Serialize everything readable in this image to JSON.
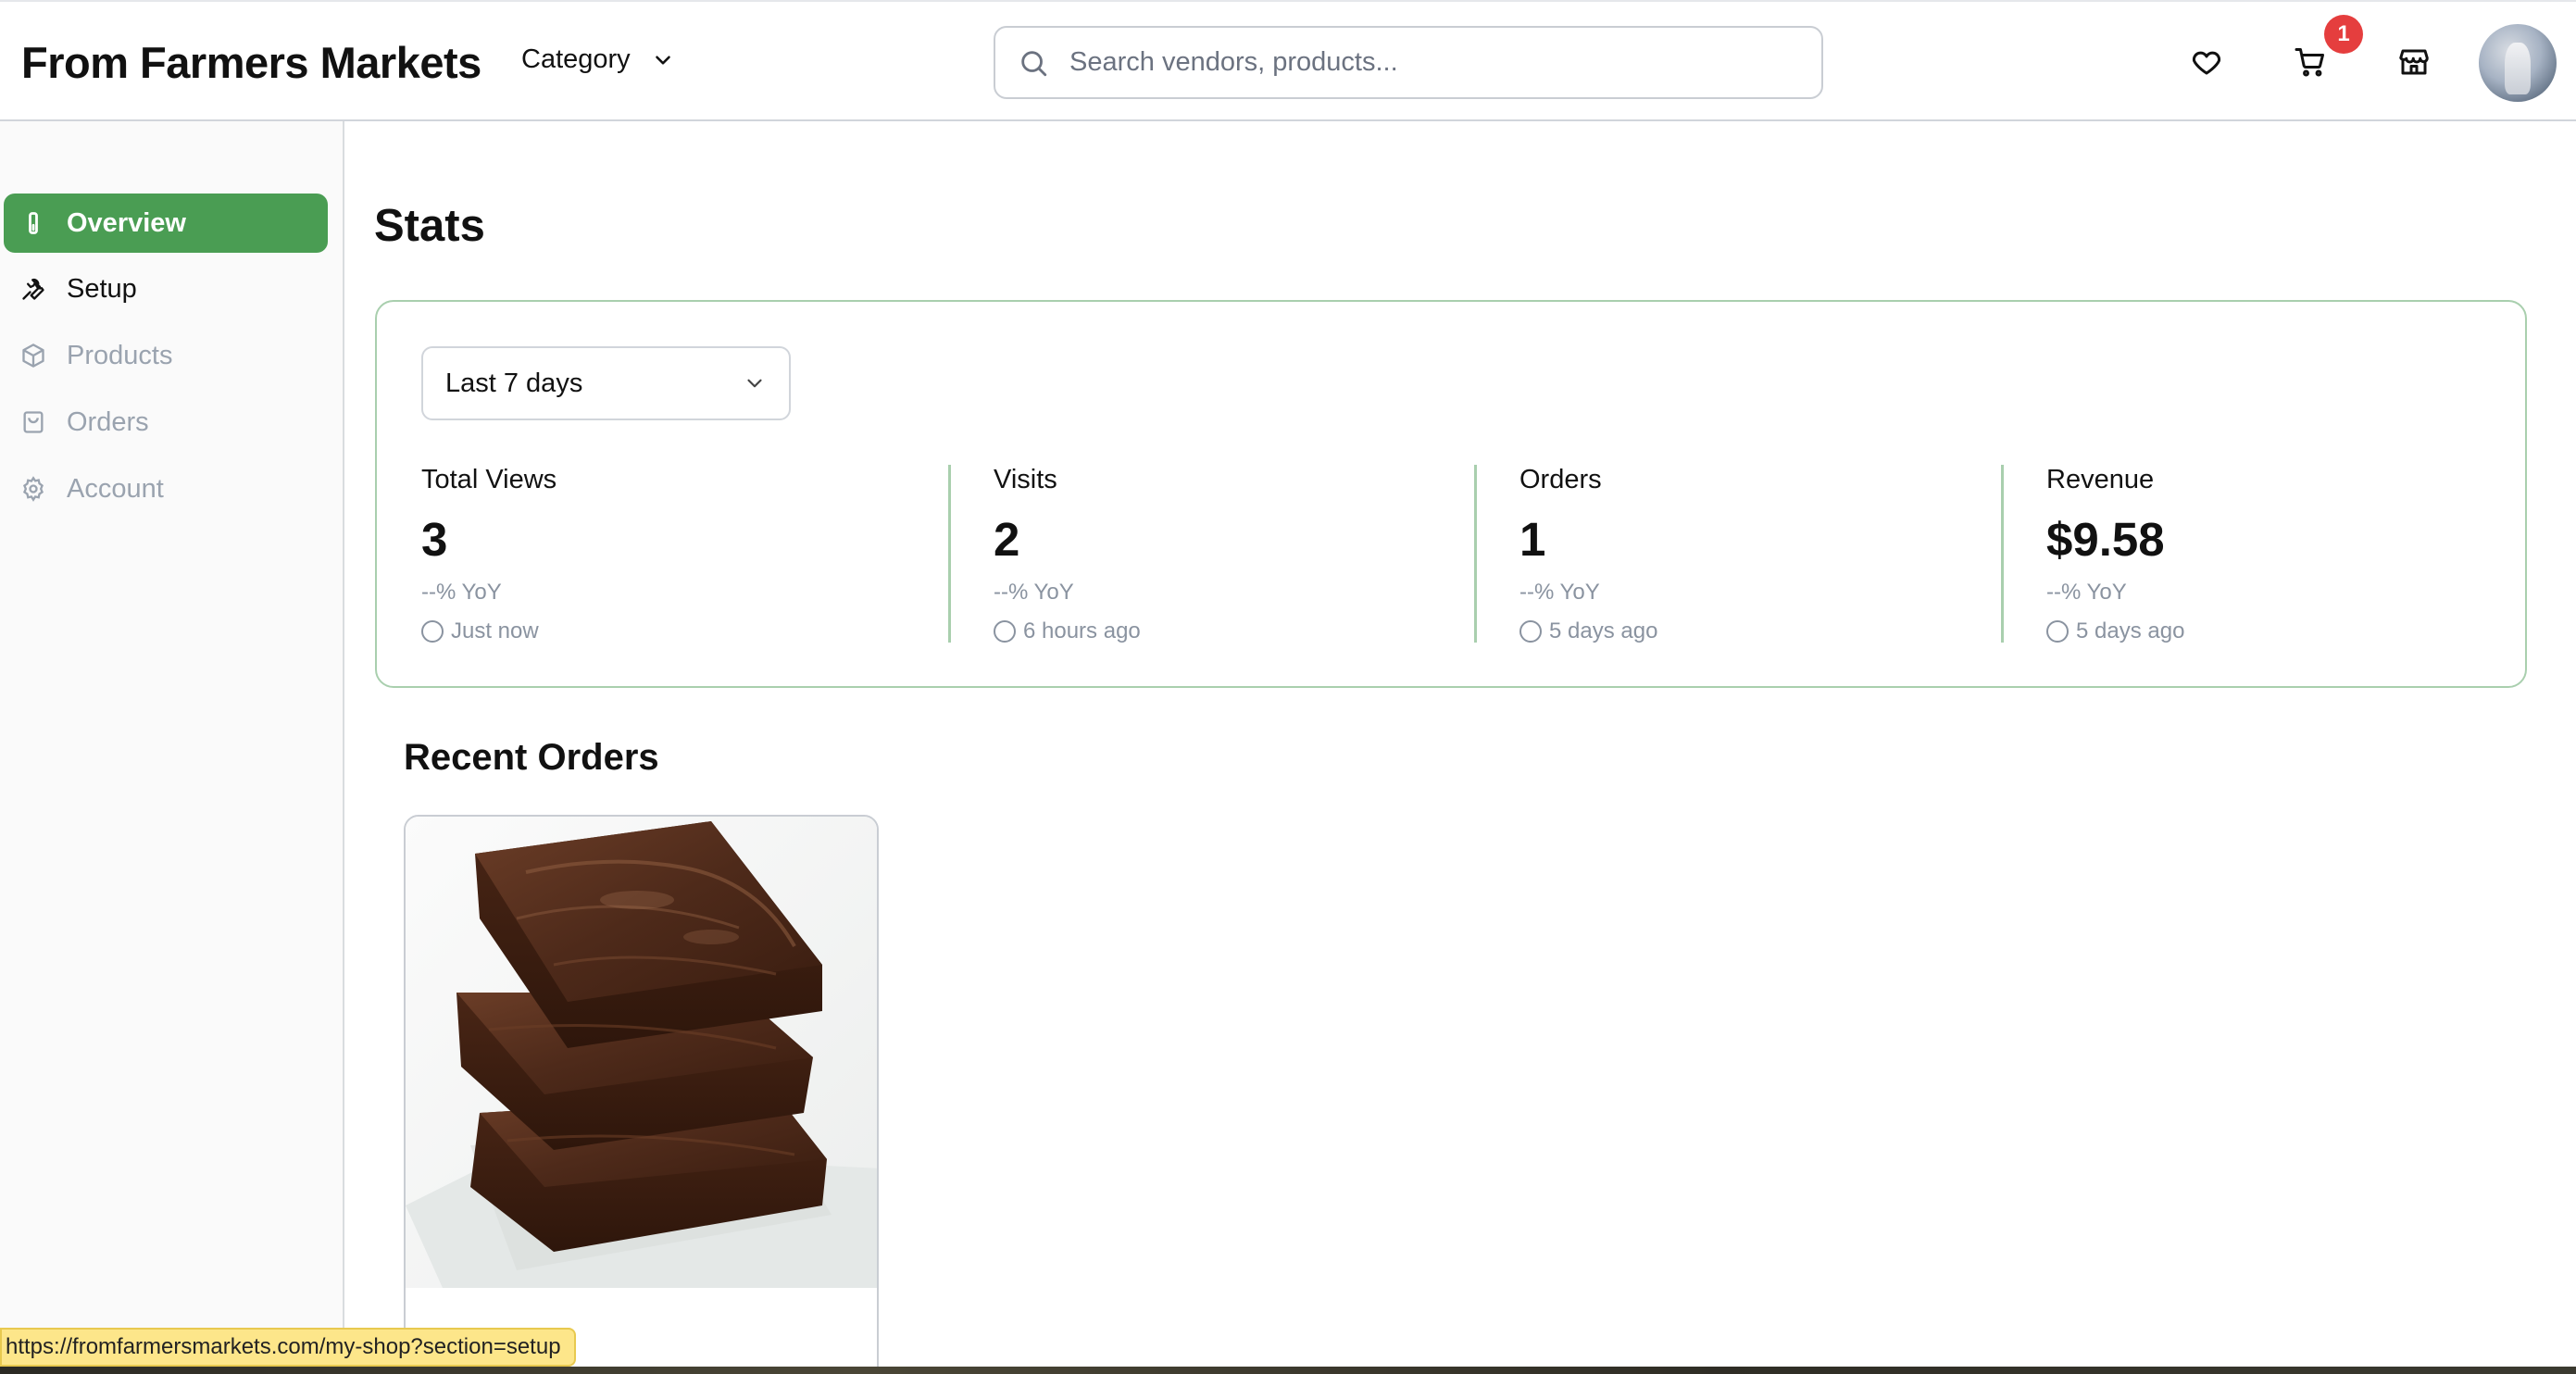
{
  "header": {
    "brand": "From Farmers Markets",
    "category_label": "Category",
    "search_placeholder": "Search vendors, products...",
    "cart_count": "1"
  },
  "sidebar": {
    "items": [
      {
        "label": "Overview",
        "icon": "thermometer-icon",
        "state": "active"
      },
      {
        "label": "Setup",
        "icon": "wrench-icon",
        "state": "hover"
      },
      {
        "label": "Products",
        "icon": "box-icon",
        "state": "default"
      },
      {
        "label": "Orders",
        "icon": "shopping-bag-icon",
        "state": "default"
      },
      {
        "label": "Account",
        "icon": "gear-icon",
        "state": "default"
      }
    ]
  },
  "main": {
    "stats_title": "Stats",
    "range": "Last 7 days",
    "stats": [
      {
        "label": "Total Views",
        "value": "3",
        "yoy": "--% YoY",
        "time": "Just now"
      },
      {
        "label": "Visits",
        "value": "2",
        "yoy": "--% YoY",
        "time": "6 hours ago"
      },
      {
        "label": "Orders",
        "value": "1",
        "yoy": "--% YoY",
        "time": "5 days ago"
      },
      {
        "label": "Revenue",
        "value": "$9.58",
        "yoy": "--% YoY",
        "time": "5 days ago"
      }
    ],
    "recent_orders_title": "Recent Orders"
  },
  "status_bar": {
    "url": "https://fromfarmersmarkets.com/my-shop?section=setup"
  },
  "colors": {
    "accent_green": "#4a9d53",
    "card_border": "#a9cfae",
    "badge_red": "#e53e3e",
    "status_yellow": "#fde68a"
  }
}
